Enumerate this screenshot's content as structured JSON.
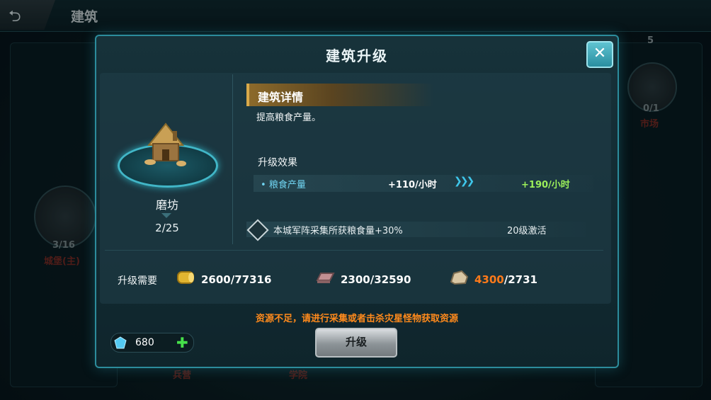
{
  "topbar": {
    "title": "建筑"
  },
  "background": {
    "labels": [
      {
        "text": "5"
      },
      {
        "text": "0/1"
      },
      {
        "text": "市场"
      },
      {
        "text": "3/16"
      },
      {
        "text": "城堡(主)"
      },
      {
        "text": "兵营"
      },
      {
        "text": "学院"
      }
    ]
  },
  "modal": {
    "title": "建筑升级",
    "building": {
      "name": "磨坊",
      "level": "2/25"
    },
    "details": {
      "header": "建筑详情",
      "description": "提高粮食产量。",
      "effect_title": "升级效果",
      "effect": {
        "name": "粮食产量",
        "current": "+110/小时",
        "next": "+190/小时"
      },
      "ability": {
        "text": "本城军阵采集所获粮食量+30%",
        "unlock": "20级激活"
      }
    },
    "requirements": {
      "label": "升级需要",
      "items": [
        {
          "icon": "wood-icon",
          "have": "2600",
          "need": "/77316",
          "insufficient": false
        },
        {
          "icon": "iron-icon",
          "have": "2300",
          "need": "/32590",
          "insufficient": false
        },
        {
          "icon": "stone-icon",
          "have": "4300",
          "need": "/2731",
          "insufficient": true
        }
      ]
    },
    "warning": "资源不足，请进行采集或者击杀灾星怪物获取资源",
    "gems": {
      "value": "680"
    },
    "upgrade_button": "升级"
  },
  "colors": {
    "accent": "#2c8c9c",
    "warning": "#ff8a1c",
    "next_value": "#9cf05a",
    "effect_name": "#6fd3f0"
  }
}
